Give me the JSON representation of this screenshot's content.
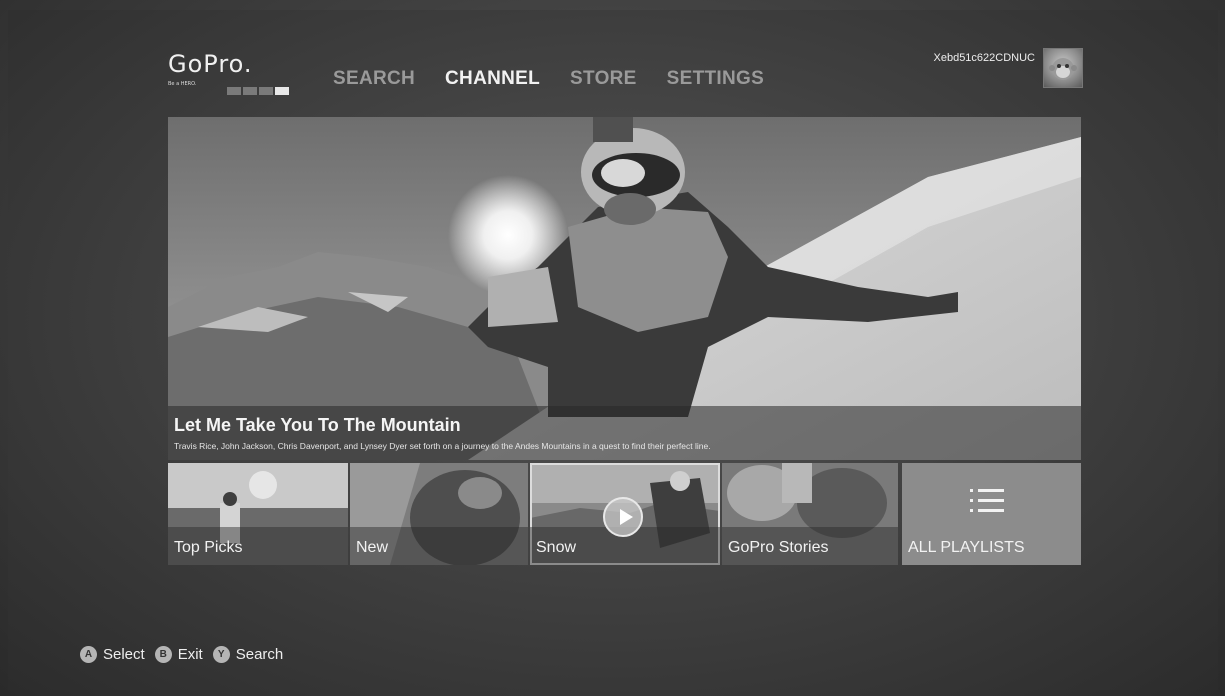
{
  "logo": {
    "word": "GoPro.",
    "tagline": "Be a HERO."
  },
  "nav": {
    "items": [
      {
        "label": "SEARCH",
        "active": false
      },
      {
        "label": "CHANNEL",
        "active": true
      },
      {
        "label": "STORE",
        "active": false
      },
      {
        "label": "SETTINGS",
        "active": false
      }
    ]
  },
  "user": {
    "gamertag": "Xebd51c622CDNUC",
    "avatar_icon": "monkey-avatar-icon"
  },
  "hero": {
    "title": "Let Me Take You To The Mountain",
    "subtitle": "Travis Rice, John Jackson, Chris Davenport, and Lynsey Dyer set forth on a journey to the Andes Mountains in a quest to find their perfect line."
  },
  "tiles": [
    {
      "label": "Top Picks"
    },
    {
      "label": "New"
    },
    {
      "label": "Snow",
      "selected": true
    },
    {
      "label": "GoPro Stories"
    },
    {
      "label": "ALL PLAYLISTS",
      "icon": "list-icon"
    }
  ],
  "hints": [
    {
      "key": "A",
      "label": "Select"
    },
    {
      "key": "B",
      "label": "Exit"
    },
    {
      "key": "Y",
      "label": "Search"
    }
  ]
}
